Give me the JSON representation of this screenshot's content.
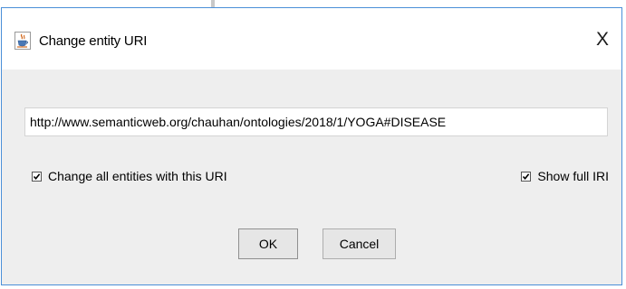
{
  "dialog": {
    "title": "Change entity URI",
    "close_label": "X",
    "icon": "java-cup-icon"
  },
  "uri_field": {
    "value": "http://www.semanticweb.org/chauhan/ontologies/2018/1/YOGA#DISEASE"
  },
  "options": {
    "change_all": {
      "label": "Change all entities with this URI",
      "checked": true
    },
    "show_full_iri": {
      "label": "Show full IRI",
      "checked": true
    }
  },
  "buttons": {
    "ok_label": "OK",
    "cancel_label": "Cancel"
  },
  "colors": {
    "dialog_border": "#4a8fd8",
    "content_background": "#eeeeee"
  }
}
